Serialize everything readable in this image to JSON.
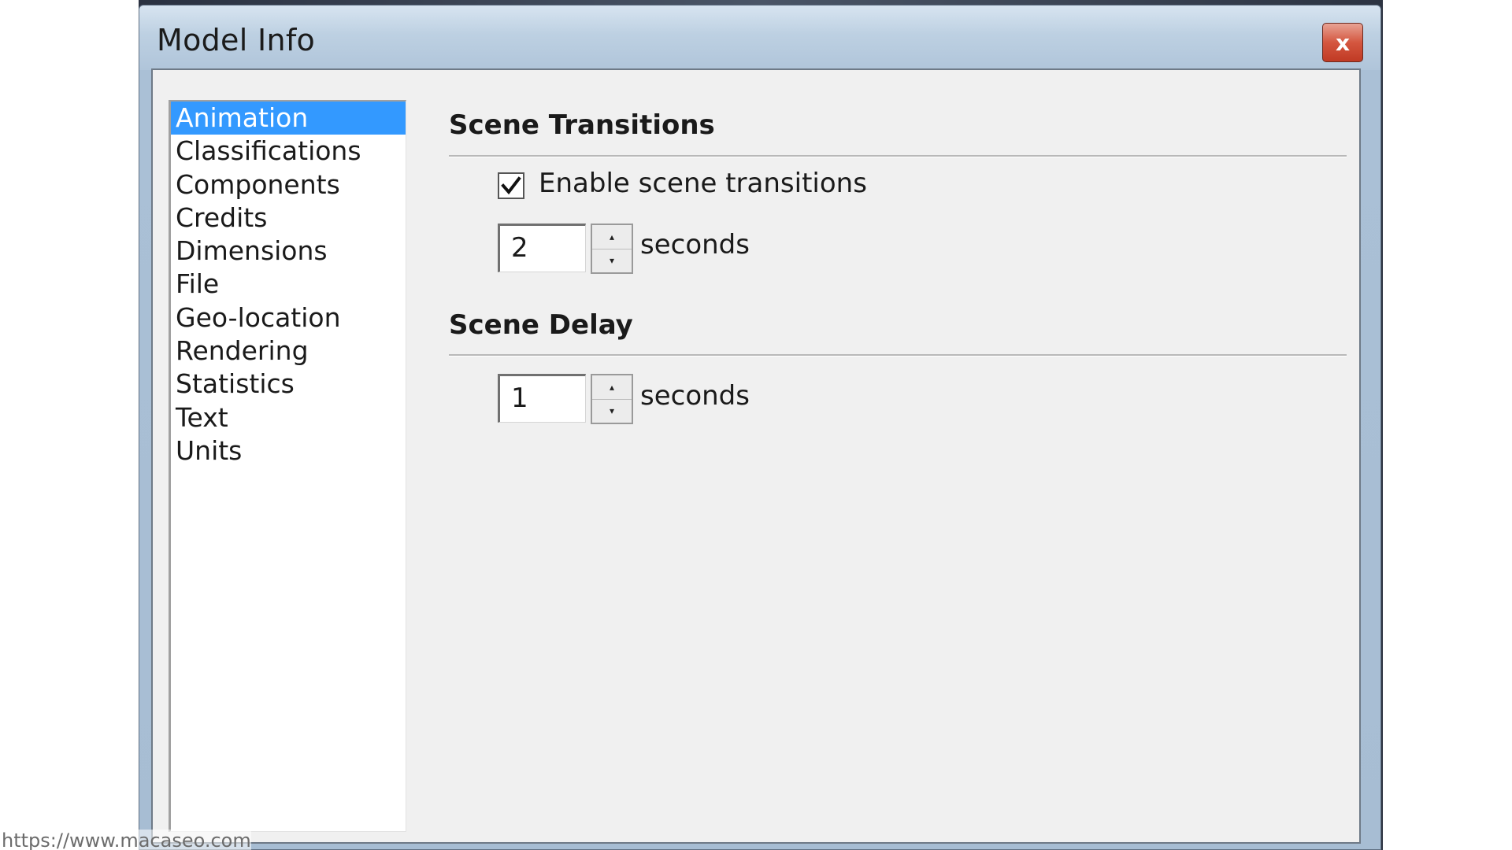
{
  "window": {
    "title": "Model Info",
    "close_label": "x"
  },
  "sidebar": {
    "items": [
      {
        "label": "Animation",
        "selected": true
      },
      {
        "label": "Classifications",
        "selected": false
      },
      {
        "label": "Components",
        "selected": false
      },
      {
        "label": "Credits",
        "selected": false
      },
      {
        "label": "Dimensions",
        "selected": false
      },
      {
        "label": "File",
        "selected": false
      },
      {
        "label": "Geo-location",
        "selected": false
      },
      {
        "label": "Rendering",
        "selected": false
      },
      {
        "label": "Statistics",
        "selected": false
      },
      {
        "label": "Text",
        "selected": false
      },
      {
        "label": "Units",
        "selected": false
      }
    ]
  },
  "scene_transitions": {
    "title": "Scene Transitions",
    "enable_label": "Enable scene transitions",
    "enabled": true,
    "duration_value": "2",
    "unit_label": "seconds"
  },
  "scene_delay": {
    "title": "Scene Delay",
    "delay_value": "1",
    "unit_label": "seconds"
  },
  "watermark": {
    "text": "https://www.macaseo.com"
  },
  "colors": {
    "selection": "#3399ff",
    "close_button": "#c9452e",
    "panel_background": "#f0f0f0"
  }
}
